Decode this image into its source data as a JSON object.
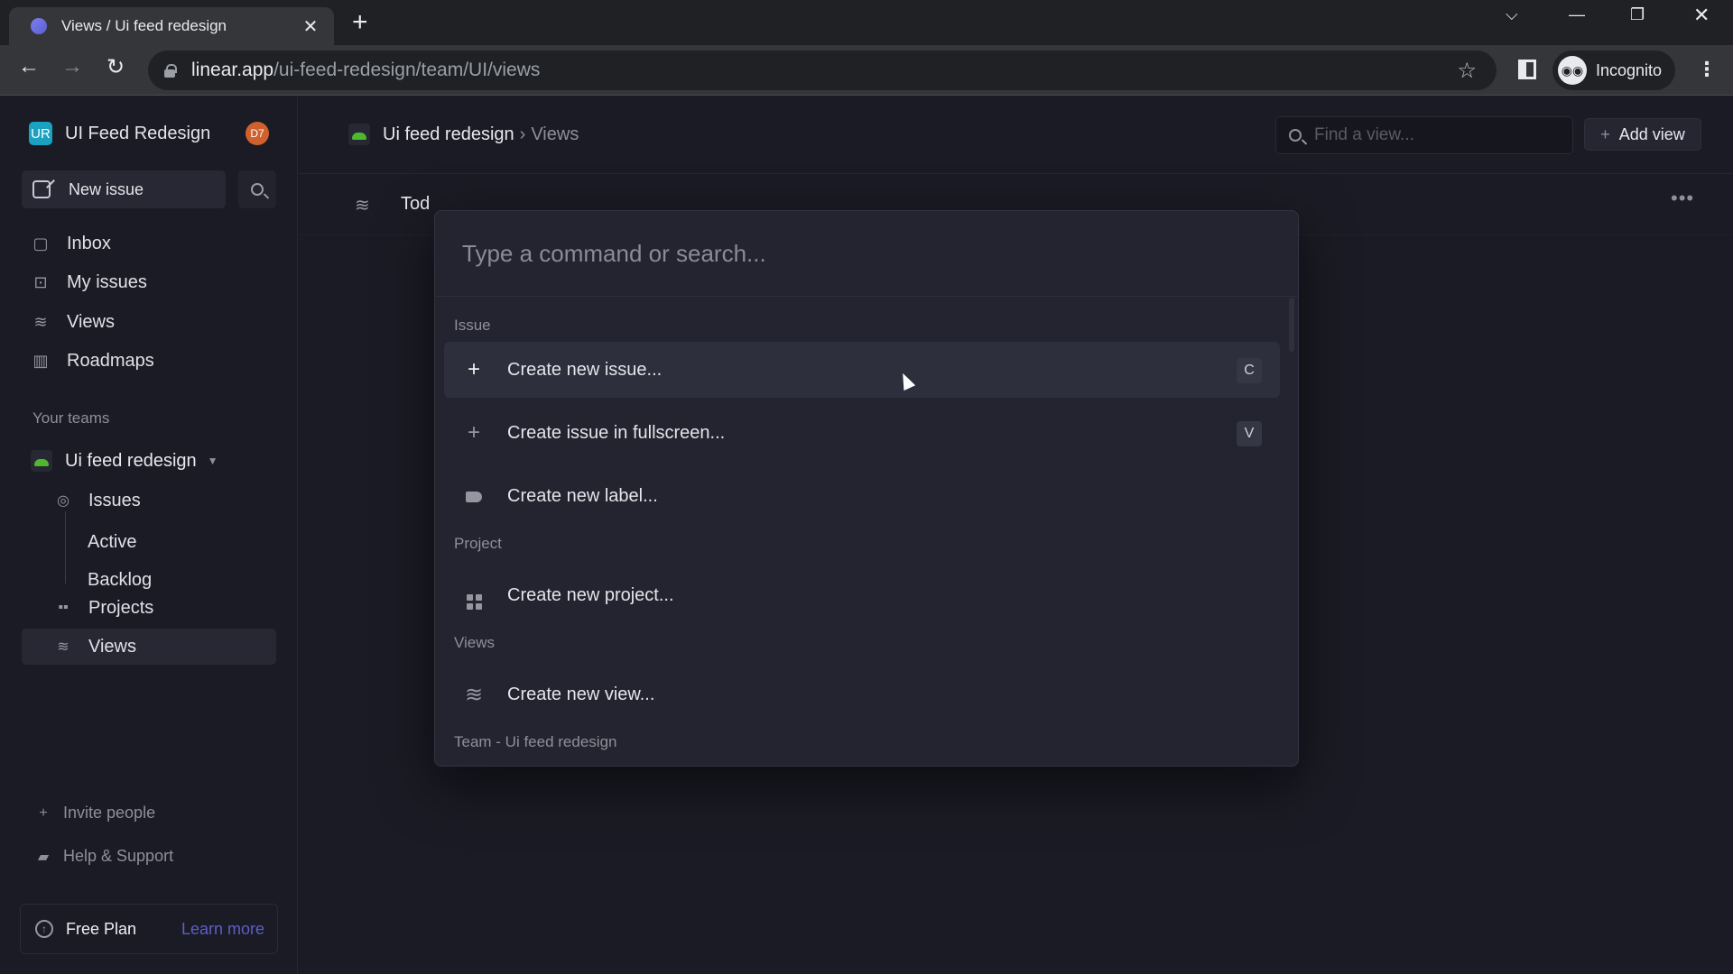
{
  "browser": {
    "tab_title": "Views / Ui feed redesign",
    "url_host": "linear.app",
    "url_path": "/ui-feed-redesign/team/UI/views",
    "profile_label": "Incognito"
  },
  "sidebar": {
    "workspace_badge": "UR",
    "workspace_name": "UI Feed Redesign",
    "user_initials": "D7",
    "new_issue_label": "New issue",
    "nav": [
      {
        "label": "Inbox",
        "icon": "inbox-icon"
      },
      {
        "label": "My issues",
        "icon": "my-issues-icon"
      },
      {
        "label": "Views",
        "icon": "views-icon"
      },
      {
        "label": "Roadmaps",
        "icon": "roadmap-icon"
      }
    ],
    "teams_label": "Your teams",
    "team": {
      "name": "Ui feed redesign",
      "items": [
        {
          "label": "Issues",
          "icon": "issues-icon"
        },
        {
          "label": "Active"
        },
        {
          "label": "Backlog"
        },
        {
          "label": "Projects",
          "icon": "projects-icon"
        },
        {
          "label": "Views",
          "icon": "views-icon",
          "active": true
        }
      ]
    },
    "invite_label": "Invite people",
    "help_label": "Help & Support",
    "plan_label": "Free Plan",
    "learn_more_label": "Learn more",
    "learn_more_color": "#5e5ec9"
  },
  "header": {
    "team": "Ui feed redesign",
    "separator": "›",
    "page": "Views",
    "find_placeholder": "Find a view...",
    "add_view_label": "Add view"
  },
  "view_row": {
    "name": "Tod"
  },
  "palette": {
    "placeholder": "Type a command or search...",
    "groups": [
      {
        "label": "Issue",
        "commands": [
          {
            "label": "Create new issue...",
            "shortcut": "C",
            "selected": true
          },
          {
            "label": "Create issue in fullscreen...",
            "shortcut": "V"
          },
          {
            "label": "Create new label..."
          }
        ]
      },
      {
        "label": "Project",
        "commands": [
          {
            "label": "Create new project..."
          }
        ]
      },
      {
        "label": "Views",
        "commands": [
          {
            "label": "Create new view..."
          }
        ]
      },
      {
        "label": "Team - Ui feed redesign",
        "commands": []
      }
    ]
  }
}
